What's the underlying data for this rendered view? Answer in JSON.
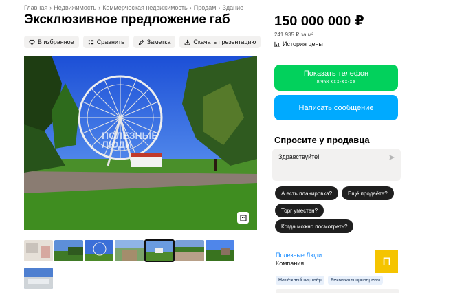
{
  "breadcrumb": [
    "Главная",
    "Недвижимость",
    "Коммерческая недвижимость",
    "Продам",
    "Здание"
  ],
  "breadcrumb_sep": "›",
  "title": "Эксклюзивное предложение габ",
  "actions": [
    {
      "label": "В избранное",
      "icon": "heart-icon"
    },
    {
      "label": "Сравнить",
      "icon": "compare-icon"
    },
    {
      "label": "Заметка",
      "icon": "note-icon"
    },
    {
      "label": "Скачать презентацию",
      "icon": "download-icon"
    }
  ],
  "photo": {
    "watermark_line1": "ПОЛЕЗНЫЕ",
    "watermark_line2": "ЛЮДИ"
  },
  "thumbnails_count": 8,
  "price": {
    "value": "150 000 000 ₽",
    "per_meter": "241 935 ₽ за м²",
    "history_label": "История цены"
  },
  "contact": {
    "phone_label": "Показать телефон",
    "phone_masked": "8 958 XXX-XX-XX",
    "message_label": "Написать сообщение",
    "phone_color": "#02d15c",
    "message_color": "#00aaff"
  },
  "ask": {
    "title": "Спросите у продавца",
    "input_value": "Здравствуйте!",
    "suggestions": [
      "А есть планировка?",
      "Ещё продаёте?",
      "Торг уместен?",
      "Когда можно посмотреть?"
    ]
  },
  "seller": {
    "name": "Полезные Люди",
    "type": "Компания",
    "logo_letter": "П",
    "logo_color": "#f5c400",
    "badges": [
      "Надёжный партнёр",
      "Реквизиты проверены"
    ]
  }
}
